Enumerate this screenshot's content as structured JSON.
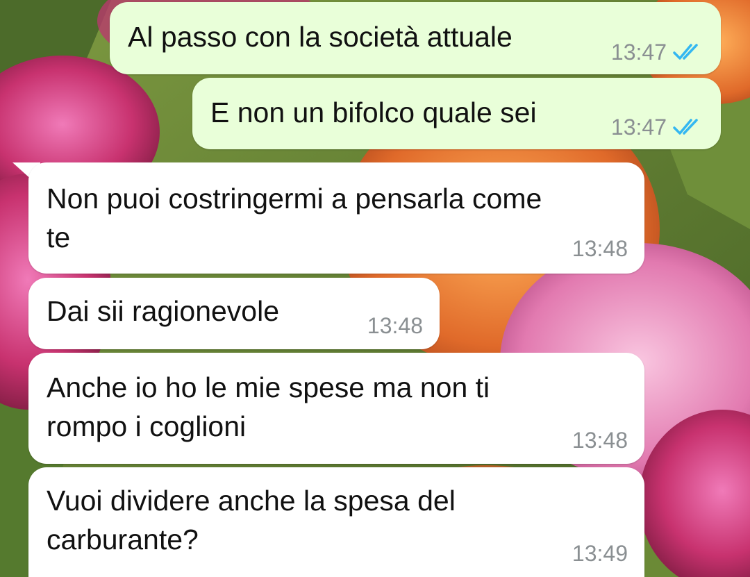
{
  "colors": {
    "outgoing_bubble": "#e9ffd9",
    "incoming_bubble": "#ffffff",
    "timestamp": "#8a8f92",
    "read_ticks": "#34b7f1"
  },
  "wallpaper": "tulips-photo",
  "messages": [
    {
      "direction": "outgoing",
      "text": "Al passo con la società attuale",
      "time": "13:47",
      "status_icon": "double-check-read-icon"
    },
    {
      "direction": "outgoing",
      "text": "E non un bifolco quale sei",
      "time": "13:47",
      "status_icon": "double-check-read-icon"
    },
    {
      "direction": "incoming",
      "text": "Non puoi costringermi a pensarla come\nte",
      "time": "13:48"
    },
    {
      "direction": "incoming",
      "text": "Dai sii ragionevole",
      "time": "13:48"
    },
    {
      "direction": "incoming",
      "text": "Anche io ho le mie spese ma non ti\nrompo i coglioni",
      "time": "13:48"
    },
    {
      "direction": "incoming",
      "text": "Vuoi dividere anche la spesa del\ncarburante?",
      "time": "13:49"
    }
  ]
}
